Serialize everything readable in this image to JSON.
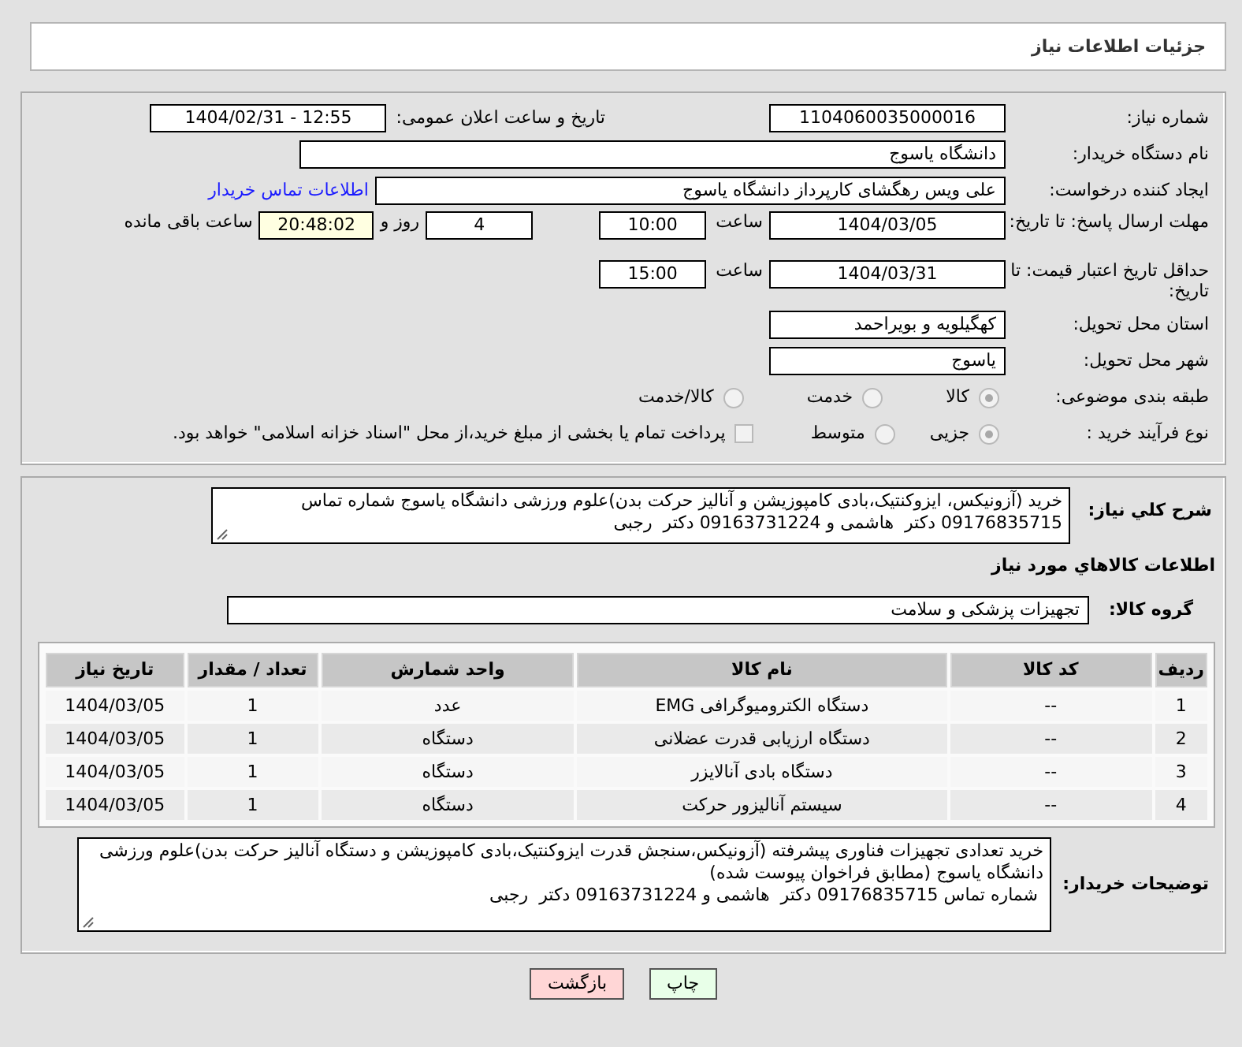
{
  "header": {
    "title": "جزئیات اطلاعات نیاز"
  },
  "need_number": {
    "label": "شماره نیاز:",
    "value": "1104060035000016"
  },
  "announce": {
    "label": "تاریخ و ساعت اعلان عمومی:",
    "value": "1404/02/31 - 12:55"
  },
  "buyer_org": {
    "label": "نام دستگاه خریدار:",
    "value": "دانشگاه یاسوج"
  },
  "requester": {
    "label": "ایجاد کننده درخواست:",
    "value": "علی ویس رهگشای کارپرداز دانشگاه یاسوج",
    "link": "اطلاعات تماس خریدار"
  },
  "response_deadline": {
    "label": "مهلت ارسال پاسخ: تا تاریخ:",
    "date": "1404/03/05",
    "time_label": "ساعت",
    "time": "10:00",
    "days": "4",
    "days_label": "روز و",
    "remaining": "20:48:02",
    "remaining_label": "ساعت باقی مانده"
  },
  "price_validity": {
    "label": "حداقل تاریخ اعتبار قیمت: تا تاریخ:",
    "date": "1404/03/31",
    "time_label": "ساعت",
    "time": "15:00"
  },
  "province": {
    "label": "استان محل تحویل:",
    "value": "کهگیلویه و بویراحمد"
  },
  "city": {
    "label": "شهر محل تحویل:",
    "value": "یاسوج"
  },
  "subject_category": {
    "label": "طبقه بندی موضوعی:",
    "options": [
      {
        "label": "کالا",
        "selected": true
      },
      {
        "label": "خدمت",
        "selected": false
      },
      {
        "label": "کالا/خدمت",
        "selected": false
      }
    ]
  },
  "purchase_process": {
    "label": "نوع فرآیند خرید :",
    "options": [
      {
        "label": "جزیی",
        "selected": true
      },
      {
        "label": "متوسط",
        "selected": false
      }
    ],
    "payment": {
      "label": "پرداخت تمام یا بخشی از مبلغ خرید،از محل \"اسناد خزانه اسلامی\" خواهد بود.",
      "checked": false
    }
  },
  "description": {
    "label": "شرح کلي نياز:",
    "value": "خرید (آزونیکس، ایزوکنتیک،بادی کامپوزیشن و آنالیز حرکت بدن)علوم ورزشی دانشگاه یاسوج شماره تماس 09176835715 دکتر  هاشمی و 09163731224 دکتر  رجبی"
  },
  "goods_info_title": "اطلاعات کالاهاي مورد نياز",
  "goods_group": {
    "label": "گروه کالا:",
    "value": "تجهیزات پزشکی و سلامت"
  },
  "table": {
    "columns": [
      "ردیف",
      "کد کالا",
      "نام کالا",
      "واحد شمارش",
      "تعداد / مقدار",
      "تاریخ نیاز"
    ],
    "rows": [
      [
        "1",
        "--",
        "دستگاه الکترومیوگرافی EMG",
        "عدد",
        "1",
        "1404/03/05"
      ],
      [
        "2",
        "--",
        "دستگاه ارزیابی قدرت عضلانی",
        "دستگاه",
        "1",
        "1404/03/05"
      ],
      [
        "3",
        "--",
        "دستگاه بادی آنالایزر",
        "دستگاه",
        "1",
        "1404/03/05"
      ],
      [
        "4",
        "--",
        "سیستم آنالیزور حرکت",
        "دستگاه",
        "1",
        "1404/03/05"
      ]
    ]
  },
  "buyer_notes": {
    "label": "توضیحات خریدار:",
    "value": "خرید تعدادی تجهیزات فناوری پیشرفته (آزونیکس،سنجش قدرت ایزوکنتیک،بادی کامپوزیشن و دستگاه آنالیز حرکت بدن)علوم ورزشی دانشگاه یاسوج (مطابق فراخوان پیوست شده)\n شماره تماس 09176835715 دکتر  هاشمی و 09163731224 دکتر  رجبی"
  },
  "buttons": [
    {
      "label": "چاپ",
      "kind": "print"
    },
    {
      "label": "بازگشت",
      "kind": "back"
    }
  ]
}
